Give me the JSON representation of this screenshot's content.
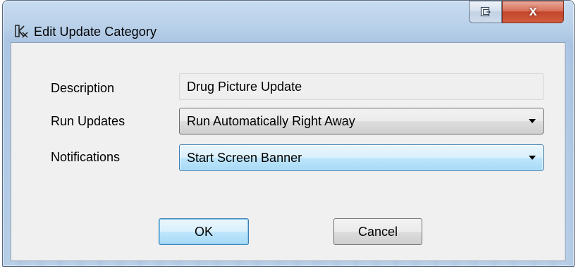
{
  "window": {
    "title": "Edit Update Category",
    "close_glyph": "x"
  },
  "form": {
    "description": {
      "label": "Description",
      "value": "Drug Picture Update"
    },
    "run_updates": {
      "label": "Run Updates",
      "value": "Run Automatically Right Away"
    },
    "notifications": {
      "label": "Notifications",
      "value": "Start Screen Banner"
    }
  },
  "buttons": {
    "ok_label": "OK",
    "cancel_label": "Cancel"
  },
  "icons": {
    "app": "app-logo-icon",
    "restore": "restore-icon",
    "close": "close-icon",
    "dropdown": "chevron-down-icon"
  },
  "colors": {
    "focus_border": "#3c7fb1",
    "close_button": "#c3452c",
    "dialog_background": "#f0f0f0"
  }
}
